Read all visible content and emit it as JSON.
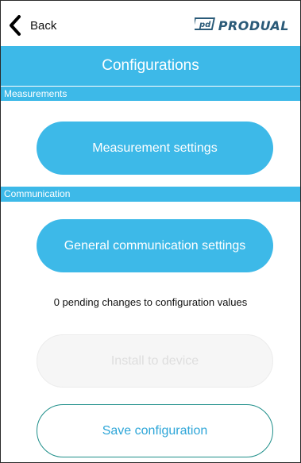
{
  "topbar": {
    "back_label": "Back",
    "brand_text": "PRODUAL"
  },
  "header": {
    "title": "Configurations"
  },
  "sections": {
    "measurements_label": "Measurements",
    "communication_label": "Communication"
  },
  "buttons": {
    "measurement_settings": "Measurement settings",
    "general_communication_settings": "General communication settings",
    "install_to_device": "Install to device",
    "save_configuration": "Save configuration"
  },
  "status": {
    "pending_text": "0 pending changes to configuration values"
  },
  "colors": {
    "accent": "#3db9e8",
    "brand": "#2a5a78",
    "outline_border": "#1f8f8a",
    "disabled_text": "#dedede"
  }
}
